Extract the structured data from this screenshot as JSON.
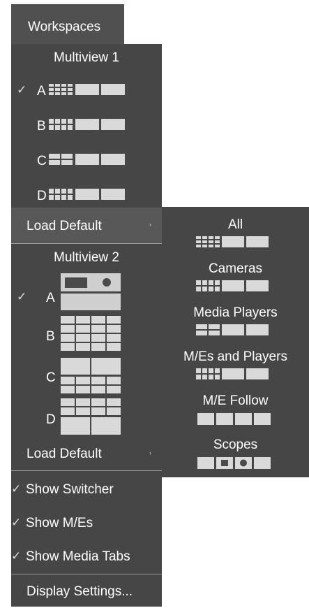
{
  "workspaces": {
    "tab_label": "Workspaces"
  },
  "multiview1": {
    "title": "Multiview 1",
    "items": [
      {
        "letter": "A",
        "checked": true,
        "icon": "layout-4x2-plus-2-icon"
      },
      {
        "letter": "B",
        "checked": false,
        "icon": "layout-4x2-plus-2-icon"
      },
      {
        "letter": "C",
        "checked": false,
        "icon": "layout-2x2-plus-2-icon"
      },
      {
        "letter": "D",
        "checked": false,
        "icon": "layout-4x2-plus-2-icon"
      }
    ],
    "load_default": "Load Default"
  },
  "multiview2": {
    "title": "Multiview 2",
    "items": [
      {
        "letter": "A",
        "checked": true,
        "icon": "layout-switcher-preview-icon"
      },
      {
        "letter": "B",
        "checked": false,
        "icon": "layout-4x4-icon"
      },
      {
        "letter": "C",
        "checked": false,
        "icon": "layout-2-plus-8-icon"
      },
      {
        "letter": "D",
        "checked": false,
        "icon": "layout-8-plus-2-icon"
      }
    ],
    "load_default": "Load Default"
  },
  "options": {
    "show_switcher": "Show Switcher",
    "show_mes": "Show M/Es",
    "show_media_tabs": "Show Media Tabs",
    "display_settings": "Display Settings..."
  },
  "check_glyph": "✓",
  "submenu_arrow": "›",
  "load_default_submenu": {
    "items": [
      {
        "label": "All",
        "icon": "layout-4x2-plus-2-icon"
      },
      {
        "label": "Cameras",
        "icon": "layout-4x2-plus-2-icon"
      },
      {
        "label": "Media Players",
        "icon": "layout-2x2-plus-2-icon"
      },
      {
        "label": "M/Es and Players",
        "icon": "layout-4x2-plus-2-icon"
      },
      {
        "label": "M/E Follow",
        "icon": "layout-4-blocks-icon"
      },
      {
        "label": "Scopes",
        "icon": "layout-scopes-icon"
      }
    ]
  }
}
